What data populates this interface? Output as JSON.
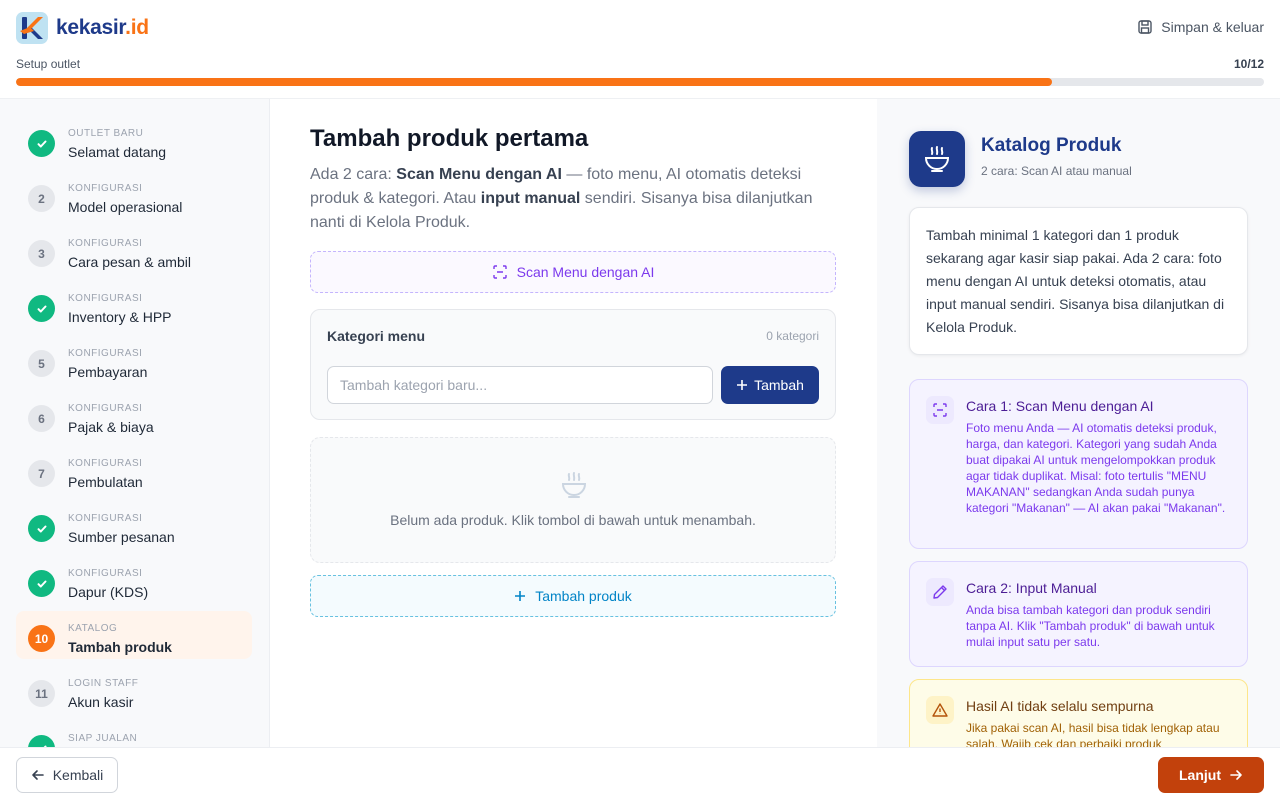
{
  "brand": {
    "name_main": "kekasir",
    "name_suffix": ".id"
  },
  "header": {
    "save_exit_label": "Simpan & keluar",
    "setup_label": "Setup outlet",
    "progress_text": "10/12",
    "progress_fraction": 0.83
  },
  "steps": [
    {
      "category": "OUTLET BARU",
      "name": "Selamat datang",
      "status": "done",
      "number": "1"
    },
    {
      "category": "KONFIGURASI",
      "name": "Model operasional",
      "status": "todo",
      "number": "2"
    },
    {
      "category": "KONFIGURASI",
      "name": "Cara pesan & ambil",
      "status": "todo",
      "number": "3"
    },
    {
      "category": "KONFIGURASI",
      "name": "Inventory & HPP",
      "status": "done",
      "number": "4"
    },
    {
      "category": "KONFIGURASI",
      "name": "Pembayaran",
      "status": "todo",
      "number": "5"
    },
    {
      "category": "KONFIGURASI",
      "name": "Pajak & biaya",
      "status": "todo",
      "number": "6"
    },
    {
      "category": "KONFIGURASI",
      "name": "Pembulatan",
      "status": "todo",
      "number": "7"
    },
    {
      "category": "KONFIGURASI",
      "name": "Sumber pesanan",
      "status": "done",
      "number": "8"
    },
    {
      "category": "KONFIGURASI",
      "name": "Dapur (KDS)",
      "status": "done",
      "number": "9"
    },
    {
      "category": "KATALOG",
      "name": "Tambah produk",
      "status": "current",
      "number": "10"
    },
    {
      "category": "LOGIN STAFF",
      "name": "Akun kasir",
      "status": "todo",
      "number": "11"
    },
    {
      "category": "SIAP JUALAN",
      "name": "",
      "status": "done",
      "number": "12"
    }
  ],
  "main": {
    "title": "Tambah produk pertama",
    "desc_part1": "Ada 2 cara: ",
    "desc_bold1": "Scan Menu dengan AI",
    "desc_part2": " — foto menu, AI otomatis deteksi produk & kategori. Atau ",
    "desc_bold2": "input manual",
    "desc_part3": " sendiri. Sisanya bisa dilanjutkan nanti di Kelola Produk.",
    "scan_button": "Scan Menu dengan AI",
    "category_title": "Kategori menu",
    "category_count": "0 kategori",
    "category_placeholder": "Tambah kategori baru...",
    "category_add_button": "Tambah",
    "empty_text": "Belum ada produk. Klik tombol di bawah untuk menambah.",
    "add_product_button": "Tambah produk"
  },
  "panel": {
    "title": "Katalog Produk",
    "subtitle": "2 cara: Scan AI atau manual",
    "info": "Tambah minimal 1 kategori dan 1 produk sekarang agar kasir siap pakai. Ada 2 cara: foto menu dengan AI untuk deteksi otomatis, atau input manual sendiri. Sisanya bisa dilanjutkan di Kelola Produk.",
    "tips": [
      {
        "title": "Cara 1: Scan Menu dengan AI",
        "body": "Foto menu Anda — AI otomatis deteksi produk, harga, dan kategori. Kategori yang sudah Anda buat dipakai AI untuk mengelompokkan produk agar tidak duplikat. Misal: foto tertulis \"MENU MAKANAN\" sedangkan Anda sudah punya kategori \"Makanan\" — AI akan pakai \"Makanan\"."
      },
      {
        "title": "Cara 2: Input Manual",
        "body": "Anda bisa tambah kategori dan produk sendiri tanpa AI. Klik \"Tambah produk\" di bawah untuk mulai input satu per satu."
      },
      {
        "title": "Hasil AI tidak selalu sempurna",
        "body": "Jika pakai scan AI, hasil bisa tidak lengkap atau salah. Wajib cek dan perbaiki produk"
      }
    ]
  },
  "footer": {
    "back_label": "Kembali",
    "next_label": "Lanjut"
  },
  "colors": {
    "accent": "#f97316",
    "brand": "#1e3a8a",
    "success": "#10b981",
    "next": "#c2410c"
  }
}
